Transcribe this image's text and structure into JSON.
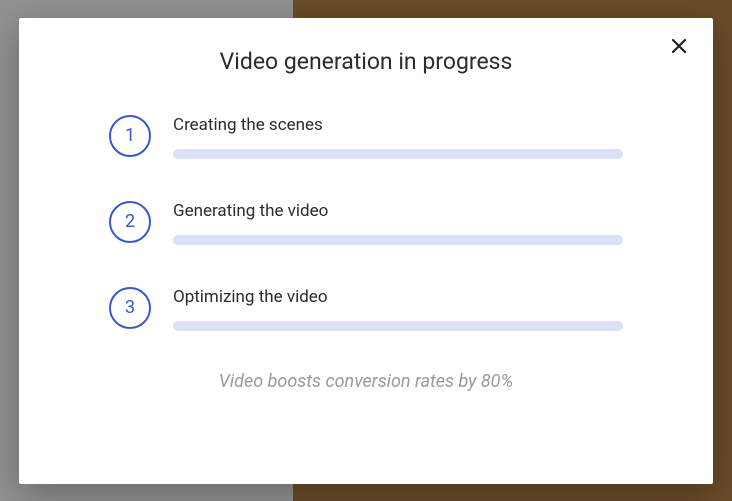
{
  "modal": {
    "title": "Video generation in progress",
    "steps": [
      {
        "number": "1",
        "label": "Creating the scenes"
      },
      {
        "number": "2",
        "label": "Generating the video"
      },
      {
        "number": "3",
        "label": "Optimizing the video"
      }
    ],
    "footer": "Video boosts conversion rates by 80%"
  }
}
